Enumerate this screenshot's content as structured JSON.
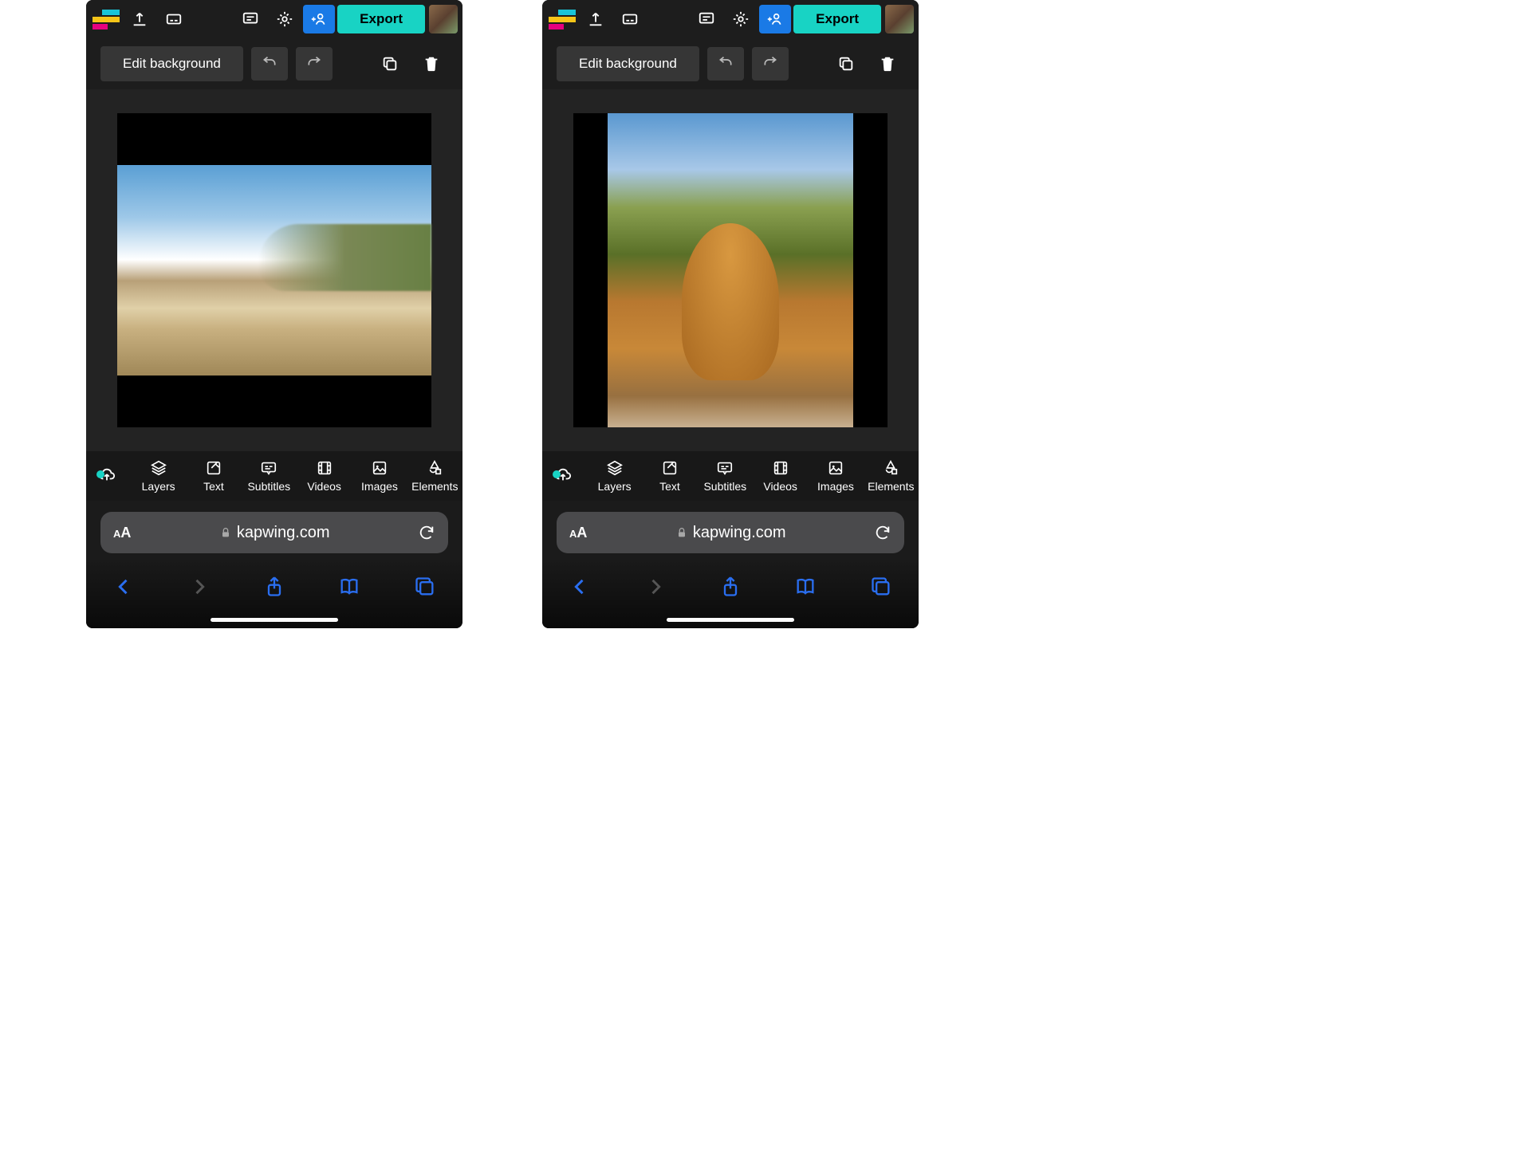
{
  "header": {
    "export_label": "Export"
  },
  "subtoolbar": {
    "edit_background_label": "Edit background"
  },
  "tools": {
    "layers": "Layers",
    "text": "Text",
    "subtitles": "Subtitles",
    "videos": "Videos",
    "images": "Images",
    "elements": "Elements"
  },
  "address_bar": {
    "domain": "kapwing.com"
  },
  "screens": [
    {
      "canvas_content": "landscape-photo-beach"
    },
    {
      "canvas_content": "portrait-photo-statue"
    }
  ]
}
